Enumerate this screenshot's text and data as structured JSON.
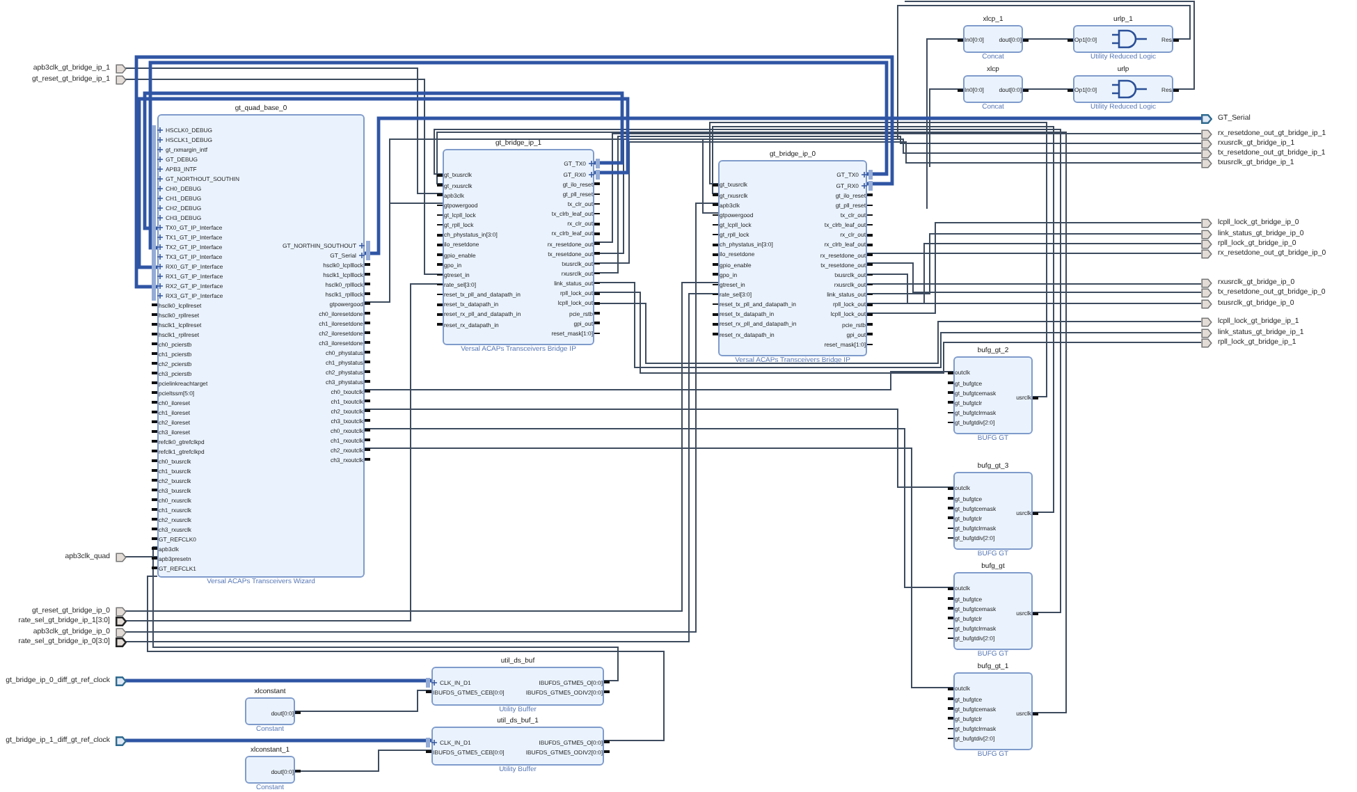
{
  "diagram": {
    "left_ports": [
      {
        "label": "apb3clk_gt_bridge_ip_1",
        "kind": "scalar"
      },
      {
        "label": "gt_reset_gt_bridge_ip_1",
        "kind": "scalar"
      },
      {
        "label": "apb3clk_quad",
        "kind": "scalar"
      },
      {
        "label": "gt_reset_gt_bridge_ip_0",
        "kind": "scalar"
      },
      {
        "label": "rate_sel_gt_bridge_ip_1[3:0]",
        "kind": "bus"
      },
      {
        "label": "apb3clk_gt_bridge_ip_0",
        "kind": "scalar"
      },
      {
        "label": "rate_sel_gt_bridge_ip_0[3:0]",
        "kind": "bus"
      },
      {
        "label": "gt_bridge_ip_0_diff_gt_ref_clock",
        "kind": "interface"
      },
      {
        "label": "gt_bridge_ip_1_diff_gt_ref_clock",
        "kind": "interface"
      }
    ],
    "right_ports": [
      {
        "label": "GT_Serial",
        "kind": "interface"
      },
      {
        "label": "rx_resetdone_out_gt_bridge_ip_1",
        "kind": "scalar"
      },
      {
        "label": "rxusrclk_gt_bridge_ip_1",
        "kind": "scalar"
      },
      {
        "label": "tx_resetdone_out_gt_bridge_ip_1",
        "kind": "scalar"
      },
      {
        "label": "txusrclk_gt_bridge_ip_1",
        "kind": "scalar"
      },
      {
        "label": "lcpll_lock_gt_bridge_ip_0",
        "kind": "scalar"
      },
      {
        "label": "link_status_gt_bridge_ip_0",
        "kind": "scalar"
      },
      {
        "label": "rpll_lock_gt_bridge_ip_0",
        "kind": "scalar"
      },
      {
        "label": "rx_resetdone_out_gt_bridge_ip_0",
        "kind": "scalar"
      },
      {
        "label": "rxusrclk_gt_bridge_ip_0",
        "kind": "scalar"
      },
      {
        "label": "tx_resetdone_out_gt_bridge_ip_0",
        "kind": "scalar"
      },
      {
        "label": "txusrclk_gt_bridge_ip_0",
        "kind": "scalar"
      },
      {
        "label": "lcpll_lock_gt_bridge_ip_1",
        "kind": "scalar"
      },
      {
        "label": "link_status_gt_bridge_ip_1",
        "kind": "scalar"
      },
      {
        "label": "rpll_lock_gt_bridge_ip_1",
        "kind": "scalar"
      }
    ],
    "blocks": [
      {
        "name": "xlcp_1",
        "type": "Concat",
        "kind": "ip",
        "left_pins": [
          "In0[0:0]"
        ],
        "right_pins": [
          "dout[0:0]"
        ]
      },
      {
        "name": "urlp_1",
        "type": "Utility Reduced Logic",
        "kind": "gate",
        "left_pins": [
          "Op1[0:0]"
        ],
        "right_pins": [
          "Res"
        ]
      },
      {
        "name": "xlcp",
        "type": "Concat",
        "kind": "ip",
        "left_pins": [
          "In0[0:0]"
        ],
        "right_pins": [
          "dout[0:0]"
        ]
      },
      {
        "name": "urlp",
        "type": "Utility Reduced Logic",
        "kind": "gate",
        "left_pins": [
          "Op1[0:0]"
        ],
        "right_pins": [
          "Res"
        ]
      },
      {
        "name": "gt_quad_base_0",
        "type": "Versal ACAPs Transceivers Wizard",
        "kind": "ip",
        "left_interfaces": [
          "HSCLK0_DEBUG",
          "HSCLK1_DEBUG",
          "gt_rxmargin_intf",
          "GT_DEBUG",
          "APB3_INTF",
          "GT_NORTHOUT_SOUTHIN",
          "CH0_DEBUG",
          "CH1_DEBUG",
          "CH2_DEBUG",
          "CH3_DEBUG",
          "TX0_GT_IP_Interface",
          "TX1_GT_IP_Interface",
          "TX2_GT_IP_Interface",
          "TX3_GT_IP_Interface",
          "RX0_GT_IP_Interface",
          "RX1_GT_IP_Interface",
          "RX2_GT_IP_Interface",
          "RX3_GT_IP_Interface"
        ],
        "left_pins": [
          "hsclk0_lcpllreset",
          "hsclk0_rpllreset",
          "hsclk1_lcpllreset",
          "hsclk1_rpllreset",
          "ch0_pcierstb",
          "ch1_pcierstb",
          "ch2_pcierstb",
          "ch3_pcierstb",
          "pcielinkreachtarget",
          "pcieltssm[5:0]",
          "ch0_iloreset",
          "ch1_iloreset",
          "ch2_iloreset",
          "ch3_iloreset",
          "refclk0_gtrefclkpd",
          "refclk1_gtrefclkpd",
          "ch0_txusrclk",
          "ch1_txusrclk",
          "ch2_txusrclk",
          "ch3_txusrclk",
          "ch0_rxusrclk",
          "ch1_rxusrclk",
          "ch2_rxusrclk",
          "ch3_rxusrclk",
          "GT_REFCLK0",
          "apb3clk",
          "apb3presetn",
          "GT_REFCLK1"
        ],
        "right_interfaces": [
          "GT_NORTHIN_SOUTHOUT",
          "GT_Serial"
        ],
        "right_pins": [
          "hsclk0_lcplllock",
          "hsclk1_lcplllock",
          "hsclk0_rplllock",
          "hsclk1_rplllock",
          "gtpowergood",
          "ch0_iloresetdone",
          "ch1_iloresetdone",
          "ch2_iloresetdone",
          "ch3_iloresetdone",
          "ch0_phystatus",
          "ch1_phystatus",
          "ch2_phystatus",
          "ch3_phystatus",
          "ch0_txoutclk",
          "ch1_txoutclk",
          "ch2_txoutclk",
          "ch3_txoutclk",
          "ch0_rxoutclk",
          "ch1_rxoutclk",
          "ch2_rxoutclk",
          "ch3_rxoutclk"
        ]
      },
      {
        "name": "gt_bridge_ip_1",
        "type": "Versal ACAPs Transceivers Bridge IP",
        "kind": "ip",
        "left_pins": [
          "gt_txusrclk",
          "gt_rxusrclk",
          "apb3clk",
          "gtpowergood",
          "gt_lcpll_lock",
          "gt_rpll_lock",
          "ch_phystatus_in[3:0]",
          "ilo_resetdone",
          "gpio_enable",
          "gpo_in",
          "gtreset_in",
          "rate_sel[3:0]",
          "reset_tx_pll_and_datapath_in",
          "reset_tx_datapath_in",
          "reset_rx_pll_and_datapath_in",
          "reset_rx_datapath_in"
        ],
        "right_interfaces": [
          "GT_TX0",
          "GT_RX0"
        ],
        "right_pins": [
          "gt_ilo_reset",
          "gt_pll_reset",
          "tx_clr_out",
          "tx_clrb_leaf_out",
          "rx_clr_out",
          "rx_clrb_leaf_out",
          "rx_resetdone_out",
          "tx_resetdone_out",
          "txusrclk_out",
          "rxusrclk_out",
          "link_status_out",
          "rpll_lock_out",
          "lcpll_lock_out",
          "pcie_rstb",
          "gpi_out",
          "reset_mask[1:0]"
        ]
      },
      {
        "name": "gt_bridge_ip_0",
        "type": "Versal ACAPs Transceivers Bridge IP",
        "kind": "ip",
        "left_pins": [
          "gt_txusrclk",
          "gt_rxusrclk",
          "apb3clk",
          "gtpowergood",
          "gt_lcpll_lock",
          "gt_rpll_lock",
          "ch_phystatus_in[3:0]",
          "ilo_resetdone",
          "gpio_enable",
          "gpo_in",
          "gtreset_in",
          "rate_sel[3:0]",
          "reset_tx_pll_and_datapath_in",
          "reset_tx_datapath_in",
          "reset_rx_pll_and_datapath_in",
          "reset_rx_datapath_in"
        ],
        "right_interfaces": [
          "GT_TX0",
          "GT_RX0"
        ],
        "right_pins": [
          "gt_ilo_reset",
          "gt_pll_reset",
          "tx_clr_out",
          "tx_clrb_leaf_out",
          "rx_clr_out",
          "rx_clrb_leaf_out",
          "rx_resetdone_out",
          "tx_resetdone_out",
          "txusrclk_out",
          "rxusrclk_out",
          "link_status_out",
          "rpll_lock_out",
          "lcpll_lock_out",
          "pcie_rstb",
          "gpi_out",
          "reset_mask[1:0]"
        ]
      },
      {
        "name": "bufg_gt_2",
        "type": "BUFG GT",
        "kind": "ip",
        "left_pins": [
          "outclk",
          "gt_bufgtce",
          "gt_bufgtcemask",
          "gt_bufgtclr",
          "gt_bufgtclrmask",
          "gt_bufgtdiv[2:0]"
        ],
        "right_pins": [
          "usrclk"
        ]
      },
      {
        "name": "bufg_gt_3",
        "type": "BUFG GT",
        "kind": "ip",
        "left_pins": [
          "outclk",
          "gt_bufgtce",
          "gt_bufgtcemask",
          "gt_bufgtclr",
          "gt_bufgtclrmask",
          "gt_bufgtdiv[2:0]"
        ],
        "right_pins": [
          "usrclk"
        ]
      },
      {
        "name": "bufg_gt",
        "type": "BUFG GT",
        "kind": "ip",
        "left_pins": [
          "outclk",
          "gt_bufgtce",
          "gt_bufgtcemask",
          "gt_bufgtclr",
          "gt_bufgtclrmask",
          "gt_bufgtdiv[2:0]"
        ],
        "right_pins": [
          "usrclk"
        ]
      },
      {
        "name": "xlconstant",
        "type": "Constant",
        "kind": "ip",
        "right_pins": [
          "dout[0:0]"
        ]
      },
      {
        "name": "xlconstant_1",
        "type": "Constant",
        "kind": "ip",
        "right_pins": [
          "dout[0:0]"
        ]
      },
      {
        "name": "util_ds_buf",
        "type": "Utility Buffer",
        "kind": "ip",
        "left_interfaces": [
          "CLK_IN_D1"
        ],
        "left_pins": [
          "IBUFDS_GTME5_CEB[0:0]"
        ],
        "right_pins": [
          "IBUFDS_GTME5_O[0:0]",
          "IBUFDS_GTME5_ODIV2[0:0]"
        ]
      },
      {
        "name": "util_ds_buf_1",
        "type": "Utility Buffer",
        "kind": "ip",
        "left_interfaces": [
          "CLK_IN_D1"
        ],
        "left_pins": [
          "IBUFDS_GTME5_CEB[0:0]"
        ],
        "right_pins": [
          "IBUFDS_GTME5_O[0:0]",
          "IBUFDS_GTME5_ODIV2[0:0]"
        ]
      },
      {
        "name": "bufg_gt_1",
        "type": "BUFG GT",
        "kind": "ip",
        "left_pins": [
          "outclk",
          "gt_bufgtce",
          "gt_bufgtcemask",
          "gt_bufgtclr",
          "gt_bufgtclrmask",
          "gt_bufgtdiv[2:0]"
        ],
        "right_pins": [
          "usrclk"
        ]
      }
    ]
  }
}
